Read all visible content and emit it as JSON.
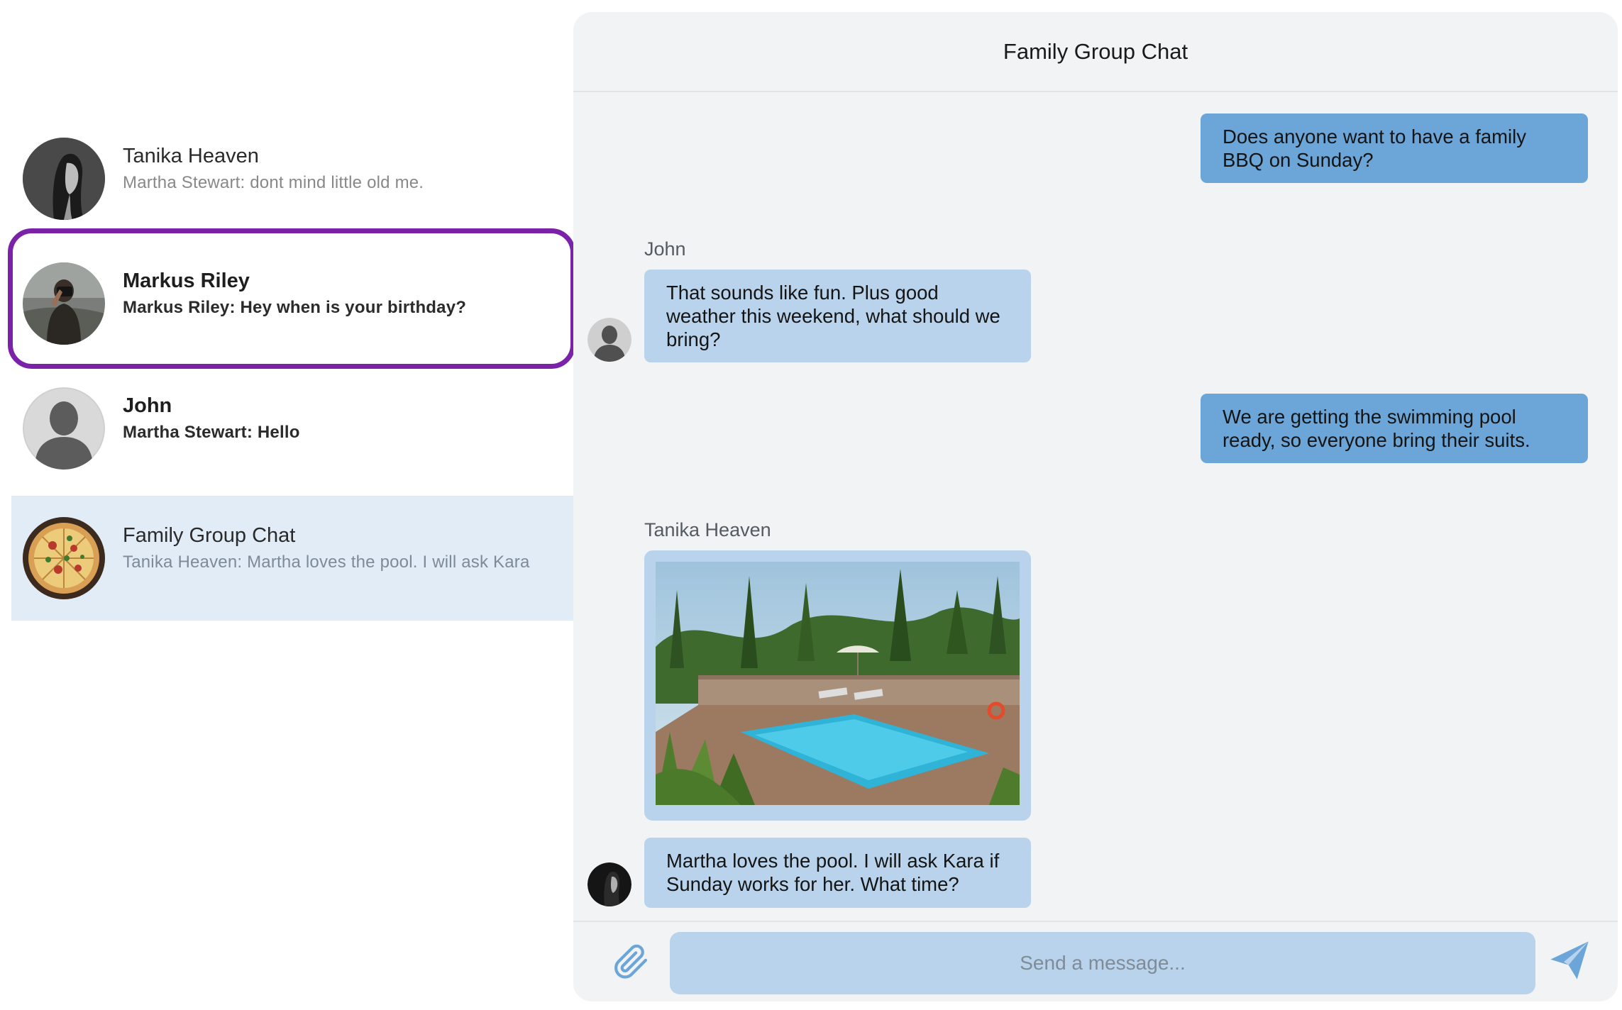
{
  "sidebar": {
    "conversations": [
      {
        "name": "Tanika Heaven",
        "preview": "Martha Stewart: dont mind little old me.",
        "unread": false,
        "active": false,
        "avatar_icon": "woman-portrait-avatar"
      },
      {
        "name": "Markus Riley",
        "preview": "Markus Riley: Hey when is your birthday?",
        "unread": true,
        "active": false,
        "avatar_icon": "photographer-avatar"
      },
      {
        "name": "John",
        "preview": "Martha Stewart: Hello",
        "unread": true,
        "active": false,
        "avatar_icon": "default-person-avatar"
      },
      {
        "name": "Family Group Chat",
        "preview": "Tanika Heaven: Martha loves the pool. I will ask Kara",
        "unread": false,
        "active": true,
        "avatar_icon": "pizza-avatar"
      }
    ],
    "highlight_color": "#7a22a8",
    "active_bg": "#e1ecf7"
  },
  "chat": {
    "title": "Family Group Chat",
    "messages": [
      {
        "direction": "out",
        "text": "Does anyone want to have a family BBQ on Sunday?"
      },
      {
        "direction": "in",
        "sender": "John",
        "text": "That sounds like fun. Plus good weather this weekend, what should we bring?"
      },
      {
        "direction": "out",
        "text": "We are getting the swimming pool ready, so everyone bring their suits."
      },
      {
        "direction": "in",
        "sender": "Tanika Heaven",
        "type": "image",
        "image_icon": "swimming-pool-photo"
      },
      {
        "direction": "in",
        "text": "Martha loves the pool. I will ask Kara if Sunday works for her. What time?"
      }
    ],
    "outgoing_color": "#6ca6d8",
    "incoming_color": "#b8d3eb"
  },
  "composer": {
    "placeholder": "Send a message...",
    "value": "",
    "attach_icon": "paperclip-icon",
    "send_icon": "paper-plane-icon"
  }
}
